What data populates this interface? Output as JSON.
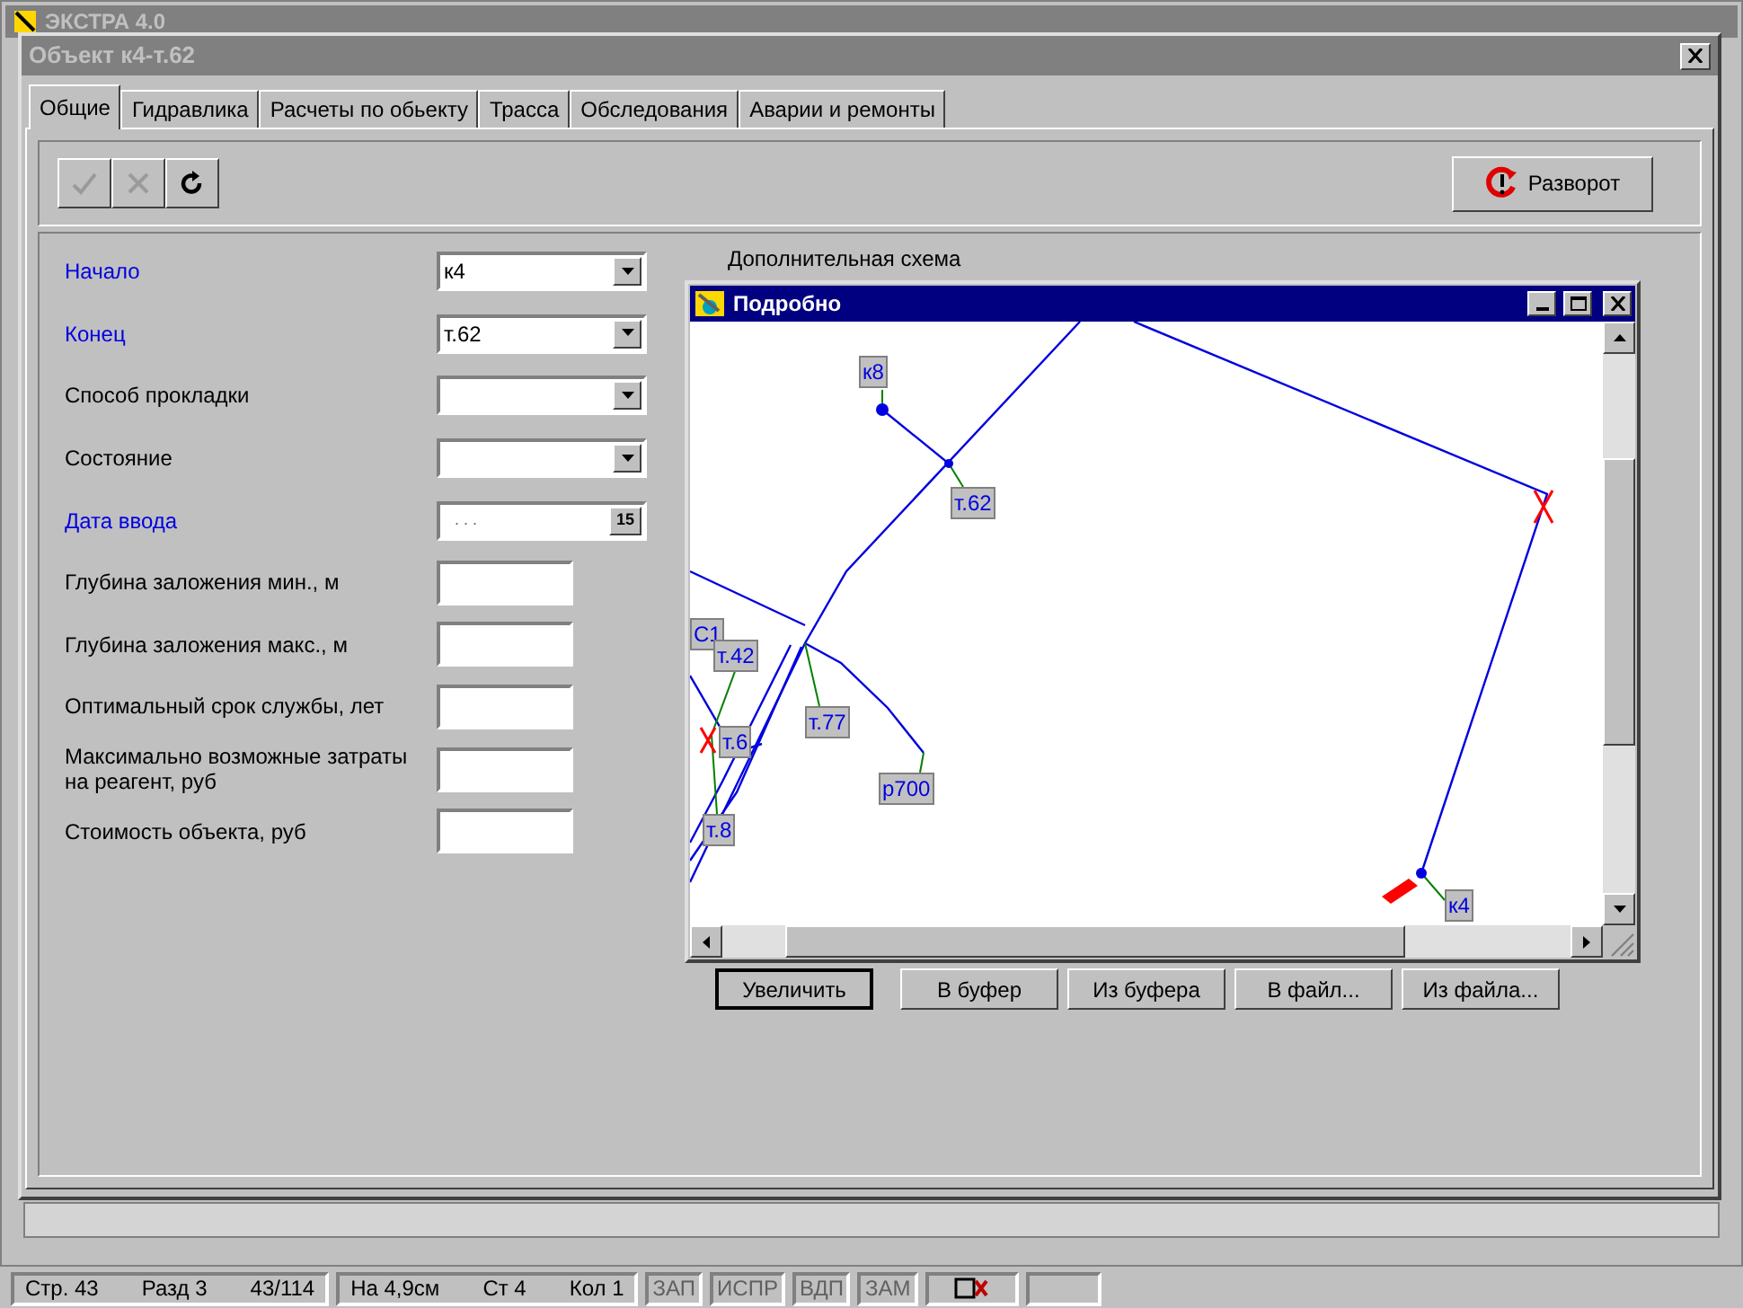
{
  "app": {
    "title": "ЭКСТРА 4.0"
  },
  "dialog": {
    "title": "Объект к4-т.62"
  },
  "tabs": [
    {
      "label": "Общие",
      "selected": true
    },
    {
      "label": "Гидравлика",
      "selected": false
    },
    {
      "label": "Расчеты по обьекту",
      "selected": false
    },
    {
      "label": "Трасса",
      "selected": false
    },
    {
      "label": "Обследования",
      "selected": false
    },
    {
      "label": "Аварии и ремонты",
      "selected": false
    }
  ],
  "toolbar": [
    {
      "kind": "check",
      "disabled": true
    },
    {
      "kind": "cancel",
      "disabled": true
    },
    {
      "kind": "refresh",
      "disabled": false
    }
  ],
  "reverse_button": {
    "label": "Разворот"
  },
  "fields": [
    {
      "label": "Начало",
      "required": true,
      "kind": "combo",
      "value": "к4"
    },
    {
      "label": "Конец",
      "required": true,
      "kind": "combo",
      "value": "т.62"
    },
    {
      "label": "Способ прокладки",
      "required": false,
      "kind": "combo"
    },
    {
      "label": "Состояние",
      "required": false,
      "kind": "combo"
    },
    {
      "label": "Дата ввода",
      "required": true,
      "kind": "date",
      "value": ". . .",
      "calendar": "15"
    },
    {
      "label": "Глубина заложения мин., м",
      "required": false,
      "kind": "text"
    },
    {
      "label": "Глубина заложения макс., м",
      "required": false,
      "kind": "text"
    },
    {
      "label": "Оптимальный срок службы, лет",
      "required": false,
      "kind": "text"
    },
    {
      "label": "Максимально возможные затраты на реагент, руб",
      "required": false,
      "kind": "text"
    },
    {
      "label": "Стоимость объекта, руб",
      "required": false,
      "kind": "text"
    }
  ],
  "scheme": {
    "caption": "Дополнительная схема",
    "window_title": "Подробно",
    "labels": [
      "к8",
      "т.62",
      "С1",
      "т.42",
      "т.77",
      "т.6",
      "р700",
      "т.8",
      "к4"
    ],
    "buttons": [
      {
        "label": "Увеличить",
        "default": true
      },
      {
        "label": "В буфер",
        "default": false
      },
      {
        "label": "Из буфера",
        "default": false
      },
      {
        "label": "В файл...",
        "default": false
      },
      {
        "label": "Из файла...",
        "default": false
      }
    ]
  },
  "status_bar": {
    "sections": [
      [
        "Стр. 43",
        "Разд 3",
        "43/114"
      ],
      [
        "На 4,9см",
        "Ст 4",
        "Кол 1"
      ]
    ],
    "indicators": [
      {
        "label": "ЗАП",
        "on": false
      },
      {
        "label": "ИСПР",
        "on": false
      },
      {
        "label": "ВДП",
        "on": false
      },
      {
        "label": "ЗАМ",
        "on": false
      }
    ]
  }
}
